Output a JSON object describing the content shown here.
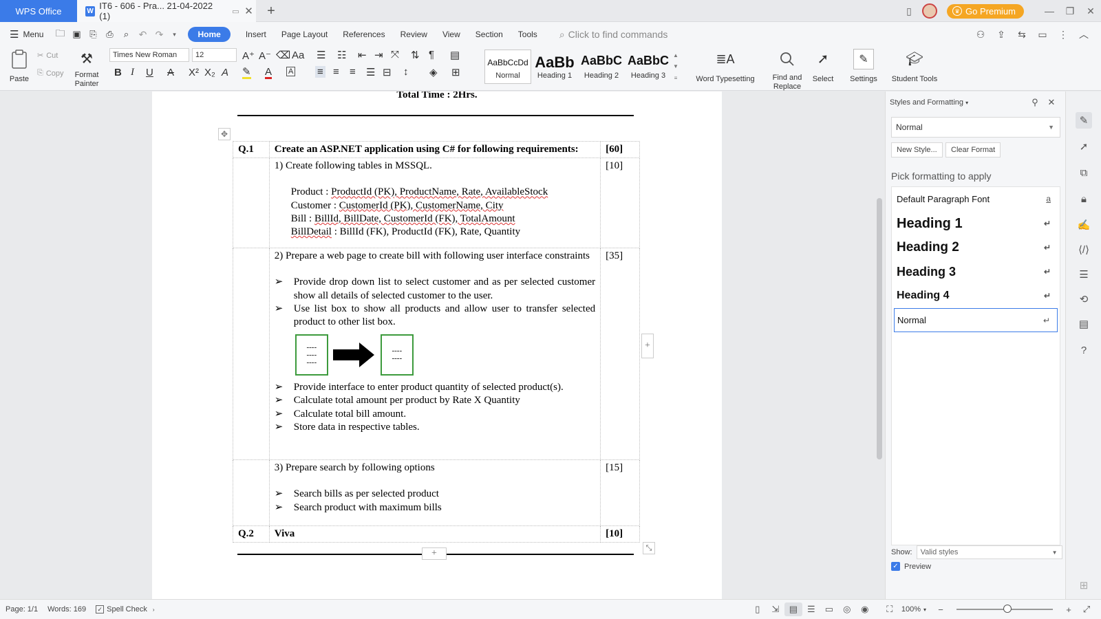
{
  "titlebar": {
    "app_name": "WPS Office",
    "doc_tab": "IT6 - 606 - Pra... 21-04-2022 (1)",
    "premium": "Go Premium"
  },
  "menu": {
    "menu_label": "Menu",
    "tabs": [
      "Home",
      "Insert",
      "Page Layout",
      "References",
      "Review",
      "View",
      "Section",
      "Tools"
    ],
    "search_placeholder": "Click to find commands"
  },
  "ribbon": {
    "paste": "Paste",
    "cut": "Cut",
    "copy": "Copy",
    "format_painter_1": "Format",
    "format_painter_2": "Painter",
    "font_name": "Times New Roman",
    "font_size": "12",
    "styles": [
      {
        "preview": "AaBbCcDd",
        "label": "Normal"
      },
      {
        "preview": "AaBb",
        "label": "Heading 1"
      },
      {
        "preview": "AaBbC",
        "label": "Heading 2"
      },
      {
        "preview": "AaBbC",
        "label": "Heading 3"
      }
    ],
    "word_typesetting": "Word Typesetting",
    "find_replace_1": "Find and",
    "find_replace_2": "Replace",
    "select": "Select",
    "settings": "Settings",
    "student_tools": "Student Tools"
  },
  "document": {
    "total_time": "Total Time : 2Hrs.",
    "q1_no": "Q.1",
    "q1_text": "Create an ASP.NET application using C# for following requirements:",
    "q1_marks": "[60]",
    "s1_text": "1)  Create following tables in MSSQL.",
    "s1_marks": "[10]",
    "tables": {
      "product_label": "Product : ",
      "product_cols": "ProductId (PK), ProductName, Rate, AvailableStock",
      "customer_label": "Customer : ",
      "customer_cols": "CustomerId (PK), CustomerName, City",
      "bill_label": "Bill : ",
      "bill_cols": "BillId, BillDate, CustomerId (FK), TotalAmount",
      "billdetail_label": "BillDetail",
      "billdetail_cols": " : BillId (FK), ProductId (FK), Rate, Quantity"
    },
    "s2_text": "2) Prepare a web page to create bill with following user interface constraints",
    "s2_marks": "[35]",
    "s2_bullets_a": [
      "Provide drop down list to select customer and as per selected customer show all details of selected customer to the user.",
      "Use list box to show all products and allow user to transfer selected product to other list box."
    ],
    "s2_bullets_b": [
      "Provide interface to enter product quantity of selected product(s).",
      "Calculate total amount per product by Rate X Quantity",
      "Calculate total bill amount.",
      "Store data in respective tables."
    ],
    "s3_text": "3)  Prepare search by following options",
    "s3_marks": "[15]",
    "s3_bullets": [
      "Search bills as per selected product",
      "Search product with maximum bills"
    ],
    "q2_no": "Q.2",
    "q2_text": "Viva",
    "q2_marks": "[10]",
    "listbox_dashes": "----"
  },
  "pane": {
    "title": "Styles and Formatting",
    "current_style": "Normal",
    "new_style": "New Style...",
    "clear_format": "Clear Format",
    "pick_label": "Pick formatting to apply",
    "styles": [
      "Default Paragraph Font",
      "Heading 1",
      "Heading 2",
      "Heading 3",
      "Heading 4",
      "Normal"
    ],
    "show_label": "Show:",
    "show_value": "Valid styles",
    "preview_label": "Preview"
  },
  "status": {
    "page": "Page: 1/1",
    "words": "Words: 169",
    "spell_check": "Spell Check",
    "zoom": "100%"
  },
  "colors": {
    "accent": "#3b7be8",
    "premium": "#f5a623",
    "listbox_border": "#3c9a3c"
  }
}
